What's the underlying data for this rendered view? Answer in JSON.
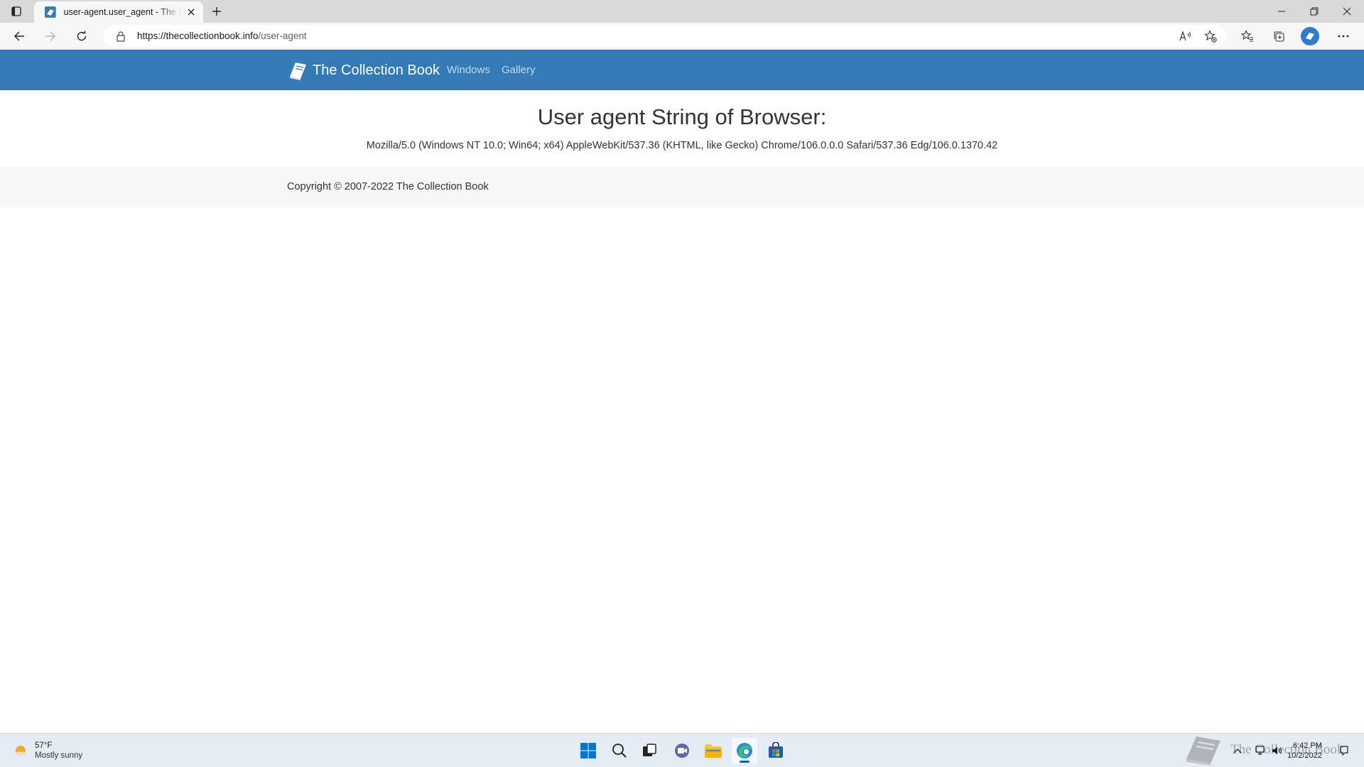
{
  "browser": {
    "tab_title": "user-agent.user_agent - The Collection Book",
    "url_host": "https://thecollectionbook.info",
    "url_path": "/user-agent"
  },
  "site": {
    "brand": "The Collection Book",
    "nav": [
      "Windows",
      "Gallery"
    ],
    "brand_color": "#337ab7"
  },
  "content": {
    "title": "User agent String of Browser:",
    "user_agent": "Mozilla/5.0 (Windows NT 10.0; Win64; x64) AppleWebKit/537.36 (KHTML, like Gecko) Chrome/106.0.0.0 Safari/537.36 Edg/106.0.1370.42"
  },
  "footer": {
    "copyright": "Copyright © 2007-2022 The Collection Book"
  },
  "taskbar": {
    "temperature": "57°F",
    "condition": "Mostly sunny",
    "time": "6:42 PM",
    "date": "10/2/2022",
    "watermark": "The Collection Book"
  }
}
